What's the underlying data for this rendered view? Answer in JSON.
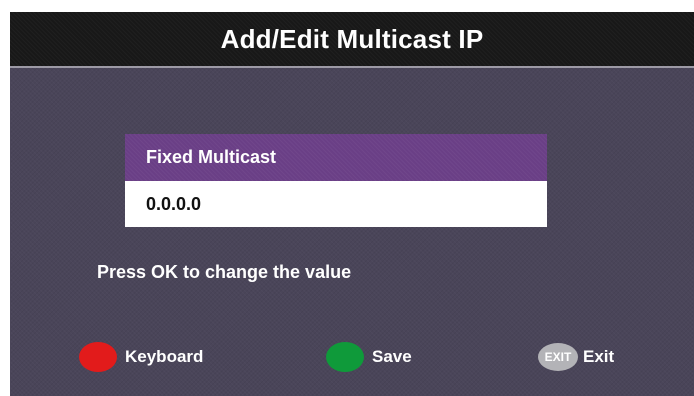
{
  "screen": {
    "title": "Add/Edit Multicast IP"
  },
  "field": {
    "label": "Fixed Multicast",
    "value": "0.0.0.0"
  },
  "hint": "Press OK to change the value",
  "actions": [
    {
      "label": "Keyboard",
      "icon": "red-button-icon",
      "color": "#e21b1b"
    },
    {
      "label": "Save",
      "icon": "green-button-icon",
      "color": "#0f9a3a"
    },
    {
      "label": "Exit",
      "icon": "exit-button-icon",
      "badge_text": "EXIT",
      "color": "#b3b3b7"
    }
  ],
  "colors": {
    "background": "#4a4559",
    "title_bar": "#181818",
    "field_header": "#6a3f86",
    "field_value_bg": "#ffffff"
  }
}
